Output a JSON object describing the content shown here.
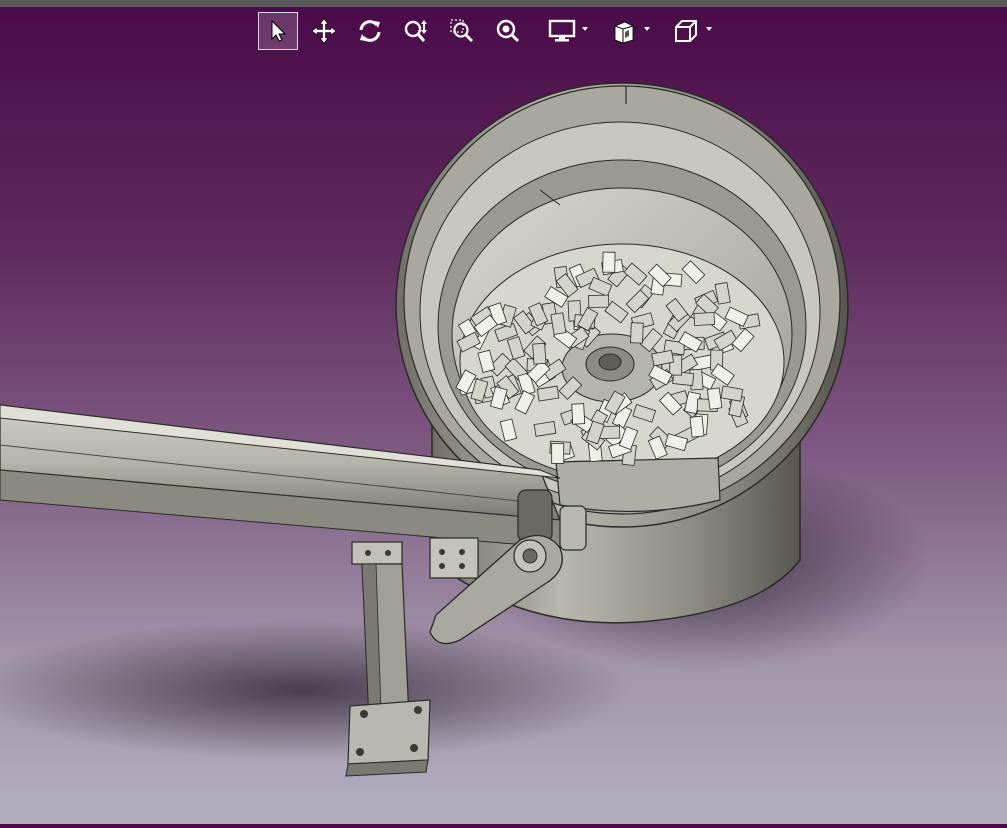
{
  "window": {
    "accent": "#4a0a48",
    "background_bottom": "#b3aebf"
  },
  "toolbar": {
    "items": [
      {
        "name": "select",
        "icon": "arrow-pointer-icon",
        "active": true
      },
      {
        "name": "pan",
        "icon": "move-arrows-icon",
        "active": false
      },
      {
        "name": "rotate",
        "icon": "rotate-icon",
        "active": false
      },
      {
        "name": "zoom-in-out",
        "icon": "zoom-updown-icon",
        "active": false
      },
      {
        "name": "zoom-area",
        "icon": "zoom-area-icon",
        "active": false
      },
      {
        "name": "fit-all",
        "icon": "zoom-fit-icon",
        "active": false
      },
      {
        "name": "display-mode",
        "icon": "monitor-icon",
        "active": false,
        "dropdown": true
      },
      {
        "name": "render-style",
        "icon": "cube-shaded-icon",
        "active": false,
        "dropdown": true
      },
      {
        "name": "view-orientation",
        "icon": "cube-wireframe-icon",
        "active": false,
        "dropdown": true
      }
    ]
  },
  "scene": {
    "description_icon": "vibratory-bowl-feeder-model",
    "colors": {
      "metal_light": "#c9c9c0",
      "metal_mid": "#9e9e94",
      "metal_dark": "#5f5f58",
      "edge": "#2a2a28"
    }
  }
}
